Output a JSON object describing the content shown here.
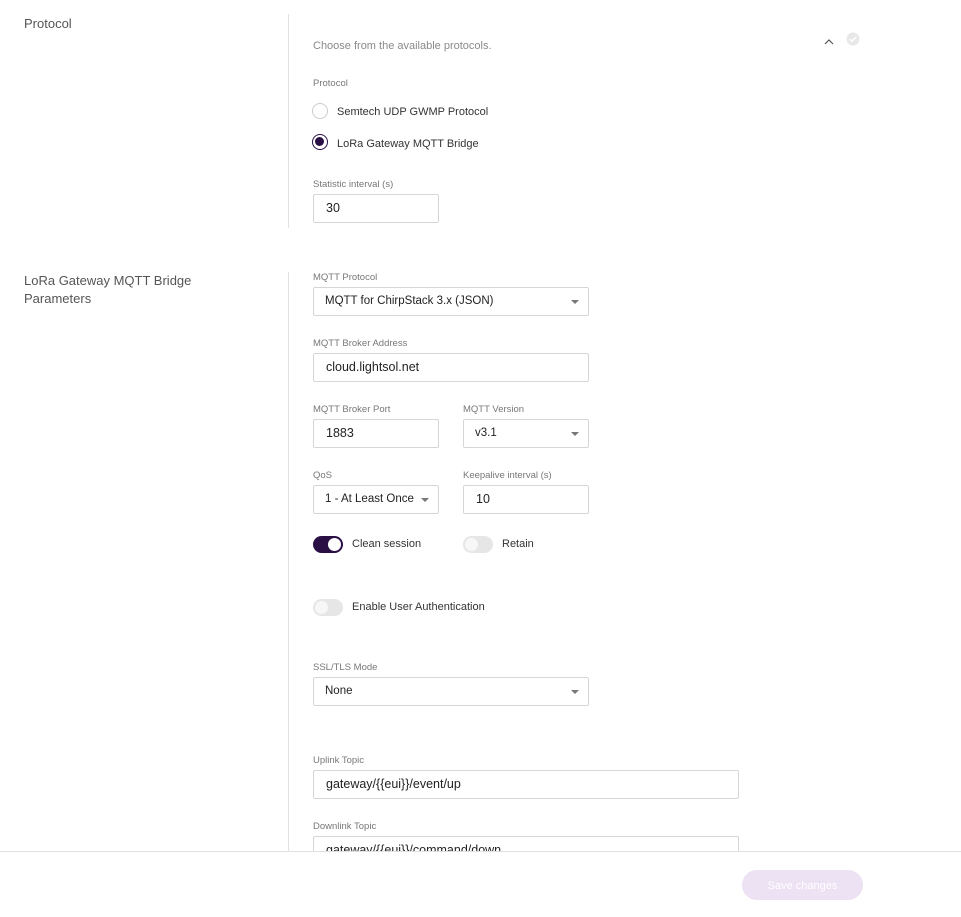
{
  "protocol_section": {
    "title": "Protocol",
    "description": "Choose from the available protocols.",
    "field_label": "Protocol",
    "options": [
      {
        "label": "Semtech UDP GWMP Protocol",
        "selected": false
      },
      {
        "label": "LoRa Gateway MQTT Bridge",
        "selected": true
      }
    ],
    "statistic_interval": {
      "label": "Statistic interval (s)",
      "value": "30"
    },
    "icons": {
      "collapse": "chevron-up-icon",
      "status": "check-circle-icon"
    }
  },
  "mqtt_section": {
    "title": "LoRa Gateway MQTT Bridge Parameters",
    "mqtt_protocol": {
      "label": "MQTT Protocol",
      "value": "MQTT for ChirpStack 3.x (JSON)"
    },
    "broker_address": {
      "label": "MQTT Broker Address",
      "value": "cloud.lightsol.net"
    },
    "broker_port": {
      "label": "MQTT Broker Port",
      "value": "1883"
    },
    "mqtt_version": {
      "label": "MQTT Version",
      "value": "v3.1"
    },
    "qos": {
      "label": "QoS",
      "value": "1 - At Least Once"
    },
    "keepalive": {
      "label": "Keepalive interval (s)",
      "value": "10"
    },
    "clean_session": {
      "label": "Clean session",
      "on": true
    },
    "retain": {
      "label": "Retain",
      "on": false
    },
    "user_auth": {
      "label": "Enable User Authentication",
      "on": false
    },
    "ssl_mode": {
      "label": "SSL/TLS Mode",
      "value": "None"
    },
    "uplink_topic": {
      "label": "Uplink Topic",
      "value": "gateway/{{eui}}/event/up"
    },
    "downlink_topic": {
      "label": "Downlink Topic",
      "value": "gateway/{{eui}}/command/down"
    }
  },
  "footer": {
    "save_label": "Save changes"
  },
  "colors": {
    "accent": "#2a0f45",
    "save_disabled": "#ede1f4"
  }
}
